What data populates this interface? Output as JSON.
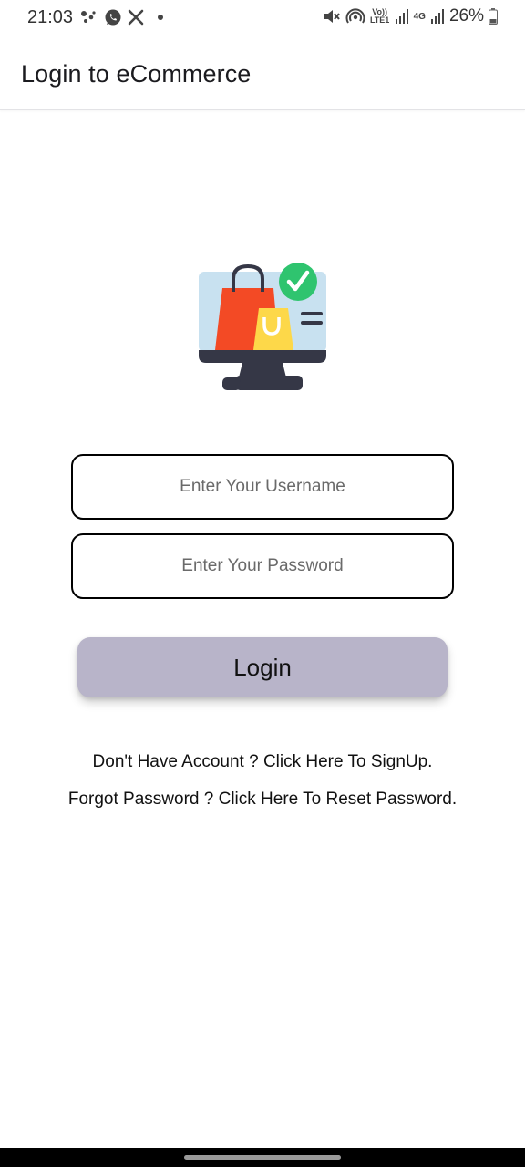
{
  "status_bar": {
    "time": "21:03",
    "battery_percent": "26%",
    "network_labels": {
      "volte": "Vo)) LTE1",
      "data": "4G"
    },
    "icons": [
      "dots-icon",
      "whatsapp-icon",
      "x-icon",
      "dot-icon",
      "mute-icon",
      "hotspot-icon",
      "signal-icon",
      "battery-icon"
    ]
  },
  "app_bar": {
    "title": "Login to eCommerce"
  },
  "form": {
    "username_placeholder": "Enter Your Username",
    "username_value": "",
    "password_placeholder": "Enter Your Password",
    "password_value": "",
    "login_label": "Login"
  },
  "links": {
    "signup": "Don't Have Account ? Click Here To SignUp.",
    "reset": "Forgot Password ? Click Here To Reset Password."
  },
  "colors": {
    "login_button": "#b8b4c9",
    "bag_red": "#f34a25",
    "bag_yellow": "#fdd849",
    "check_green": "#2fc46f",
    "monitor_screen": "#c8e1f0",
    "monitor_dark": "#353746"
  }
}
